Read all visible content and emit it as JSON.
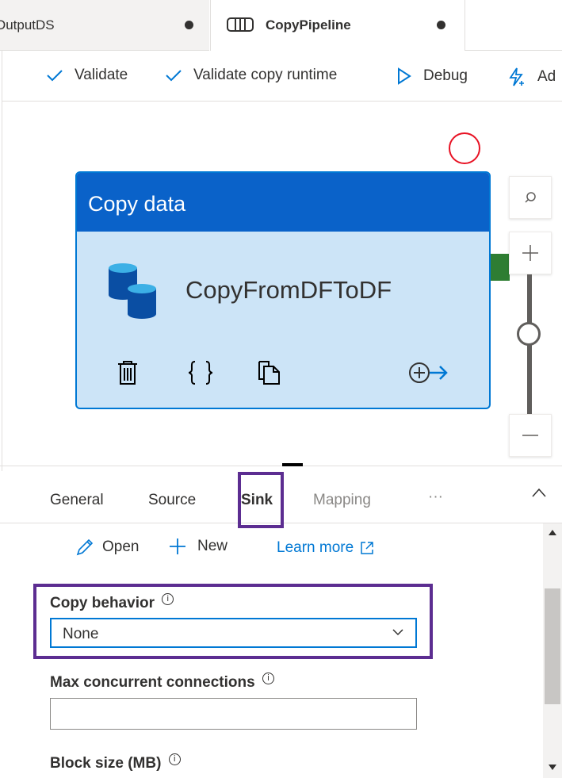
{
  "tabs": [
    {
      "title": "OutputDS",
      "dirty": true
    },
    {
      "title": "CopyPipeline",
      "dirty": true,
      "icon": "pipeline-icon"
    }
  ],
  "toolbar": {
    "validate": "Validate",
    "validate_runtime": "Validate copy runtime",
    "debug": "Debug",
    "add": "Ad"
  },
  "activity": {
    "type": "Copy data",
    "name": "CopyFromDFToDF"
  },
  "properties": {
    "tabs": [
      "General",
      "Source",
      "Sink",
      "Mapping"
    ],
    "active_tab": "Sink",
    "more": "···",
    "actions": {
      "open": "Open",
      "new": "New",
      "learn_more": "Learn more"
    },
    "copy_behavior": {
      "label": "Copy behavior",
      "value": "None"
    },
    "max_concurrent": {
      "label": "Max concurrent connections",
      "value": ""
    },
    "block_size": {
      "label": "Block size (MB)"
    }
  },
  "colors": {
    "accent": "#0078d4",
    "activity_header": "#0a62c9",
    "activity_body": "#cce4f7",
    "highlight": "#5c2d91",
    "error_circle": "#e81123",
    "connector": "#2e7d32"
  }
}
